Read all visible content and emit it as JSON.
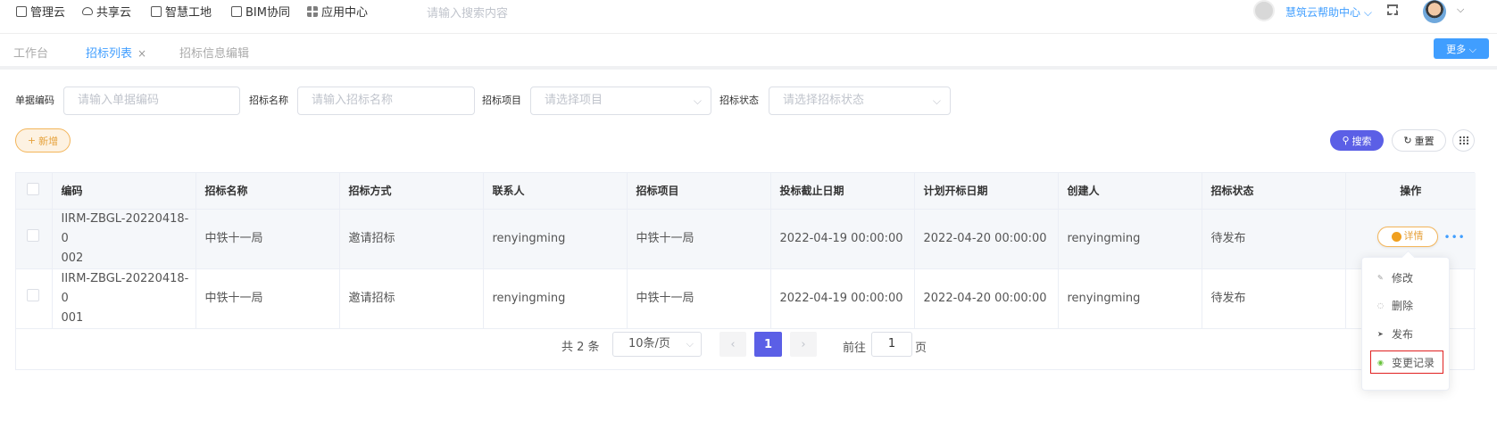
{
  "topnav": {
    "items": [
      {
        "label": "管理云",
        "icon": "book-icon"
      },
      {
        "label": "共享云",
        "icon": "cloud-icon"
      },
      {
        "label": "智慧工地",
        "icon": "book-icon"
      },
      {
        "label": "BIM协同",
        "icon": "bag-icon"
      },
      {
        "label": "应用中心",
        "icon": "grid-icon"
      }
    ],
    "search_placeholder": "请输入搜索内容",
    "help_label": "慧筑云帮助中心 ⌵"
  },
  "tabs": [
    {
      "label": "工作台",
      "active": false
    },
    {
      "label": "招标列表",
      "active": true,
      "close": "×"
    },
    {
      "label": "招标信息编辑",
      "active": false
    }
  ],
  "more_button": "更多 ⌵",
  "filters": [
    {
      "label": "单据编码",
      "placeholder": "请输入单据编码"
    },
    {
      "label": "招标名称",
      "placeholder": "请输入招标名称"
    },
    {
      "label": "招标项目",
      "placeholder": "请选择项目"
    },
    {
      "label": "招标状态",
      "placeholder": "请选择招标状态"
    }
  ],
  "actions": {
    "add": "新增",
    "search": "搜索",
    "reset": "重置"
  },
  "table": {
    "columns": [
      "编码",
      "招标名称",
      "招标方式",
      "联系人",
      "招标项目",
      "投标截止日期",
      "计划开标日期",
      "创建人",
      "招标状态",
      "操作"
    ],
    "rows": [
      {
        "code_l1": "IIRM-ZBGL-20220418-0",
        "code_l2": "002",
        "name": "中铁十一局",
        "method": "邀请招标",
        "contact": "renyingming",
        "project": "中铁十一局",
        "deadline": "2022-04-19 00:00:00",
        "open_date": "2022-04-20 00:00:00",
        "creator": "renyingming",
        "status": "待发布"
      },
      {
        "code_l1": "IIRM-ZBGL-20220418-0",
        "code_l2": "001",
        "name": "中铁十一局",
        "method": "邀请招标",
        "contact": "renyingming",
        "project": "中铁十一局",
        "deadline": "2022-04-19 00:00:00",
        "open_date": "2022-04-20 00:00:00",
        "creator": "renyingming",
        "status": "待发布"
      }
    ],
    "detail_label": "详情",
    "more_ellipsis": "•••"
  },
  "pagination": {
    "total": "共 2 条",
    "page_size": "10条/页",
    "current_page": "1",
    "goto_label": "前往",
    "goto_value": "1",
    "goto_unit": "页"
  },
  "dropdown_menu": [
    {
      "label": "修改",
      "icon": "edit-icon"
    },
    {
      "label": "删除",
      "icon": "trash-icon"
    },
    {
      "label": "发布",
      "icon": "send-icon"
    },
    {
      "label": "变更记录",
      "icon": "check-circle-icon"
    }
  ],
  "colors": {
    "primary": "#409eff",
    "accent_purple": "#5b5fe6",
    "warning": "#e6a23c",
    "highlight_border": "#e02020"
  }
}
